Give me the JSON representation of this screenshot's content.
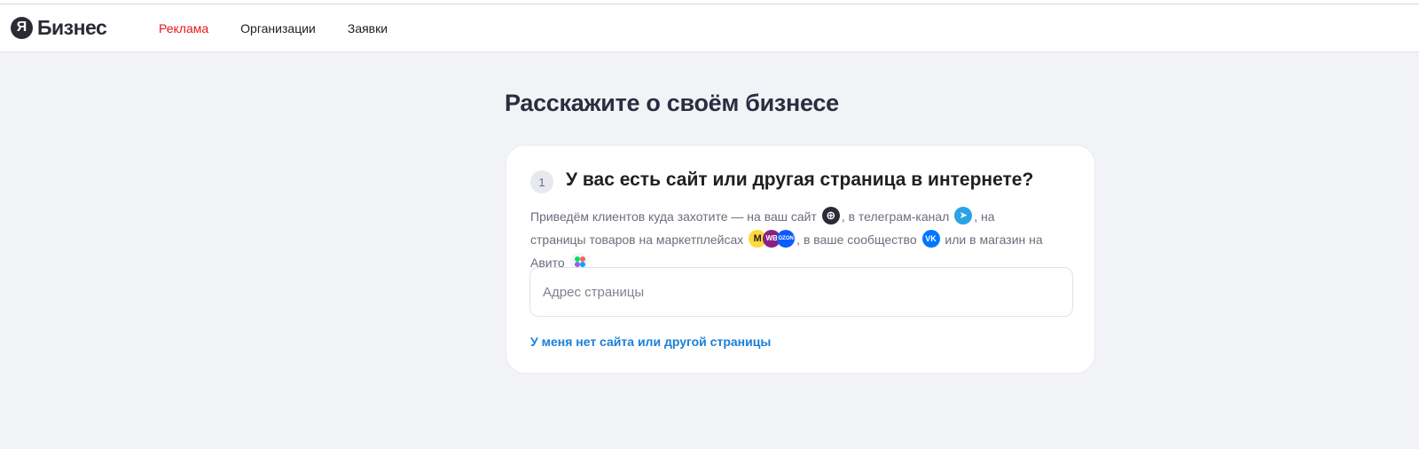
{
  "header": {
    "logo_letter": "Я",
    "logo_text": "Бизнес",
    "nav": [
      {
        "label": "Реклама",
        "active": true
      },
      {
        "label": "Организации",
        "active": false
      },
      {
        "label": "Заявки",
        "active": false
      }
    ]
  },
  "page": {
    "title": "Расскажите о своём бизнесе"
  },
  "card": {
    "step_number": "1",
    "question": "У вас есть сайт или другая страница в интернете?",
    "desc_part1": "Приведём клиентов куда захотите — на ваш сайт",
    "desc_part2": ", в телеграм-канал",
    "desc_part3": ", на страницы товаров на маркетплейсах",
    "desc_part4": ", в ваше сообщество",
    "desc_part5": "или в магазин на Авито",
    "icons": {
      "site": "globe-icon",
      "telegram": "telegram-icon",
      "marketplaces": [
        "yandex-market-icon",
        "wildberries-icon",
        "ozon-icon"
      ],
      "community": "vk-icon",
      "avito": "avito-icon"
    },
    "icon_labels": {
      "wildberries": "WB",
      "ozon": "OZON",
      "vk": "VK"
    },
    "input_placeholder": "Адрес страницы",
    "input_value": "",
    "no_site_link": "У меня нет сайта или другой страницы"
  },
  "colors": {
    "accent_red": "#e6161b",
    "link_blue": "#1a7fd8",
    "background": "#f2f3f7"
  }
}
